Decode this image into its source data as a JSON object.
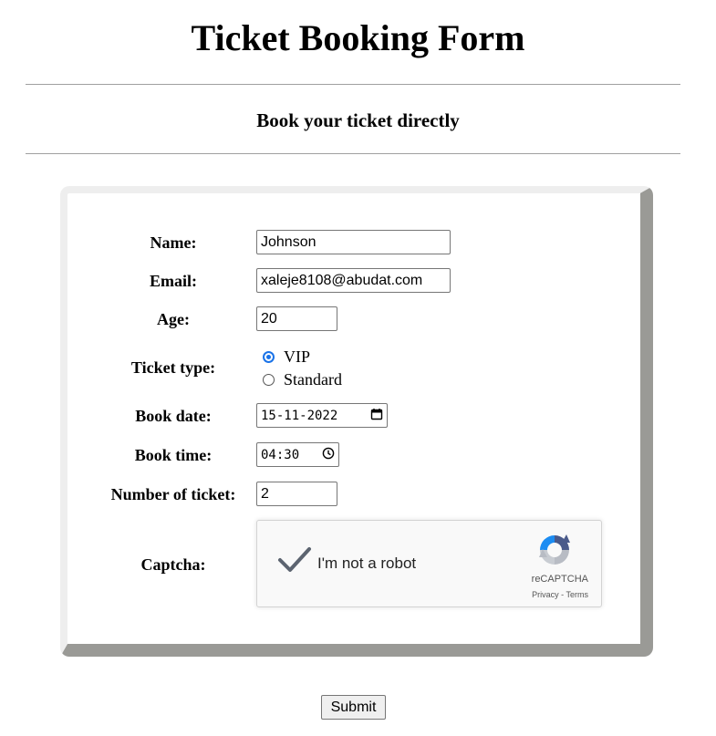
{
  "page": {
    "title": "Ticket Booking Form",
    "subtitle": "Book your ticket directly"
  },
  "form": {
    "name": {
      "label": "Name:",
      "value": "Johnson"
    },
    "email": {
      "label": "Email:",
      "value": "xaleje8108@abudat.com"
    },
    "age": {
      "label": "Age:",
      "value": "20"
    },
    "ticket_type": {
      "label": "Ticket type:",
      "options": [
        {
          "label": "VIP",
          "selected": true
        },
        {
          "label": "Standard",
          "selected": false
        }
      ]
    },
    "book_date": {
      "label": "Book date:",
      "value": "15-11-2022"
    },
    "book_time": {
      "label": "Book time:",
      "value": "04:30"
    },
    "ticket_count": {
      "label": "Number of ticket:",
      "value": "2"
    },
    "captcha": {
      "label": "Captcha:",
      "checkbox_text": "I'm not a robot",
      "brand": "reCAPTCHA",
      "links": "Privacy - Terms",
      "checked": true
    }
  },
  "actions": {
    "submit_label": "Submit"
  },
  "colors": {
    "radio_selected": "#1a73e8",
    "card_shadow": "#9a9a96",
    "captcha_check": "#5c6470"
  },
  "icons": {
    "date_picker": "calendar-icon",
    "time_picker": "clock-icon",
    "captcha_check": "checkmark-icon",
    "captcha_logo": "recaptcha-logo-icon"
  }
}
